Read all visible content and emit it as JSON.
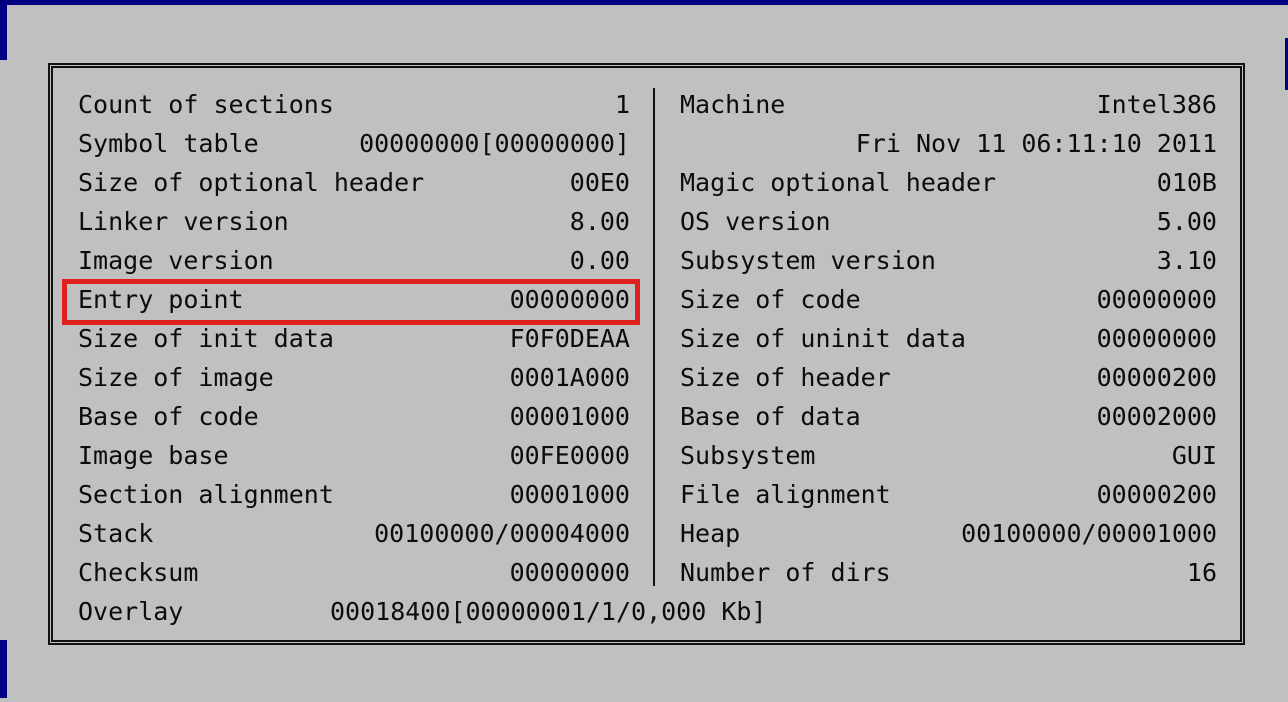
{
  "left": [
    {
      "label": "Count of sections",
      "value": "1"
    },
    {
      "label": "Symbol table",
      "value": "00000000[00000000]"
    },
    {
      "label": "Size of optional header",
      "value": "00E0"
    },
    {
      "label": "Linker version",
      "value": "8.00"
    },
    {
      "label": "Image version",
      "value": "0.00"
    },
    {
      "label": "Entry point",
      "value": "00000000"
    },
    {
      "label": "Size of init data",
      "value": "F0F0DEAA"
    },
    {
      "label": "Size of image",
      "value": "0001A000"
    },
    {
      "label": "Base of code",
      "value": "00001000"
    },
    {
      "label": "Image base",
      "value": "00FE0000"
    },
    {
      "label": "Section alignment",
      "value": "00001000"
    },
    {
      "label": "Stack",
      "value": "00100000/00004000"
    },
    {
      "label": "Checksum",
      "value": "00000000"
    }
  ],
  "right": [
    {
      "label": "Machine",
      "value": "Intel386"
    },
    {
      "label": "",
      "value": "Fri Nov 11 06:11:10 2011"
    },
    {
      "label": "Magic optional header",
      "value": "010B"
    },
    {
      "label": "OS version",
      "value": "5.00"
    },
    {
      "label": "Subsystem version",
      "value": "3.10"
    },
    {
      "label": "Size of code",
      "value": "00000000"
    },
    {
      "label": "Size of uninit data",
      "value": "00000000"
    },
    {
      "label": "Size of header",
      "value": "00000200"
    },
    {
      "label": "Base of data",
      "value": "00002000"
    },
    {
      "label": "Subsystem",
      "value": "GUI"
    },
    {
      "label": "File alignment",
      "value": "00000200"
    },
    {
      "label": "Heap",
      "value": "00100000/00001000"
    },
    {
      "label": "Number of dirs",
      "value": "16"
    }
  ],
  "overlay": {
    "label": "Overlay",
    "value": "00018400[00000001/1/0,000 Kb]"
  },
  "colors": {
    "background": "#c0c0c0",
    "highlight": "#e0201e",
    "text": "#0c0c0c"
  }
}
